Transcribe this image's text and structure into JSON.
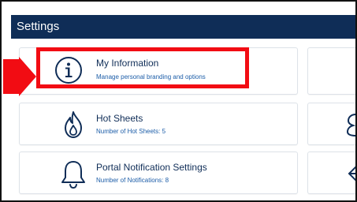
{
  "header": {
    "title": "Settings"
  },
  "cards": [
    {
      "title": "My Information",
      "subtitle": "Manage personal branding and options",
      "icon": "info-circle-icon"
    },
    {
      "title": "Hot Sheets",
      "subtitle": "Number of Hot Sheets: 5",
      "icon": "flame-icon"
    },
    {
      "title": "Portal Notification Settings",
      "subtitle": "Number of Notifications: 8",
      "icon": "bell-icon"
    }
  ],
  "colors": {
    "header_bg": "#0f2d57",
    "title_text": "#0f2d57",
    "subtitle_text": "#1c5da8",
    "highlight": "#f20c13"
  }
}
